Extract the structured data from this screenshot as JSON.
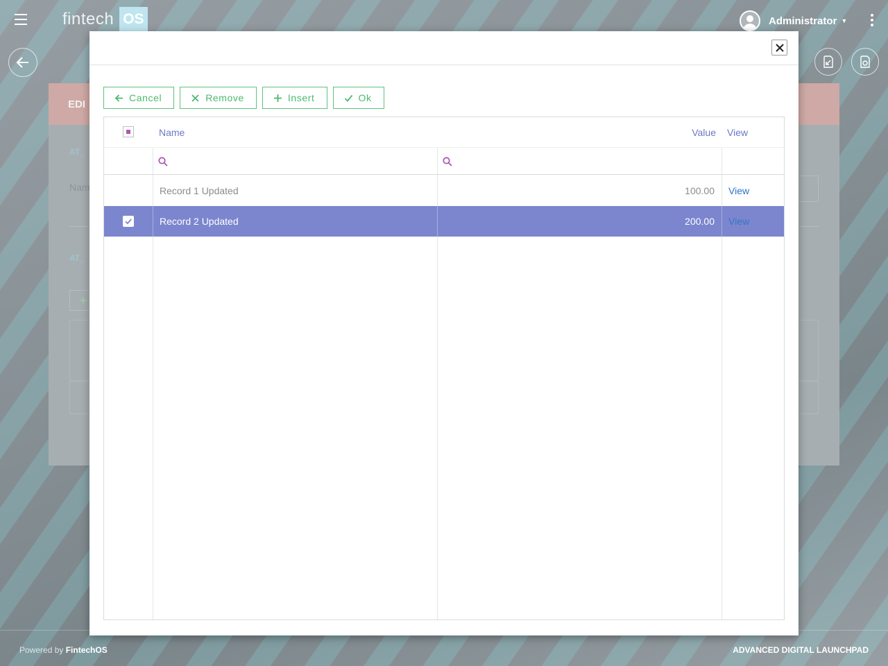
{
  "app": {
    "logo_text": "fintech",
    "logo_box": "OS",
    "user_name": "Administrator"
  },
  "background": {
    "card_title": "EDI",
    "section1_label": "AT_",
    "field_label": "Nam",
    "section2_label": "AT_",
    "add_symbol": "+"
  },
  "footer": {
    "powered_prefix": "Powered by ",
    "powered_brand": "FintechOS",
    "product": "ADVANCED DIGITAL LAUNCHPAD"
  },
  "toolbar": {
    "cancel_label": "Cancel",
    "remove_label": "Remove",
    "insert_label": "Insert",
    "ok_label": "Ok"
  },
  "grid": {
    "columns": {
      "name": "Name",
      "value": "Value",
      "view": "View"
    },
    "rows": [
      {
        "name": "Record 1 Updated",
        "value": "100.00",
        "view": "View",
        "selected": false
      },
      {
        "name": "Record 2 Updated",
        "value": "200.00",
        "view": "View",
        "selected": true
      }
    ]
  },
  "colors": {
    "accent_green": "#4eb96d",
    "header_text": "#6d78c4",
    "selected_row": "#7b86ce",
    "link": "#2e74c6",
    "partial_check": "#b157b4"
  },
  "icons": {
    "menu": "hamburger-icon",
    "back": "arrow-left-icon",
    "close": "close-icon",
    "search": "search-icon"
  }
}
